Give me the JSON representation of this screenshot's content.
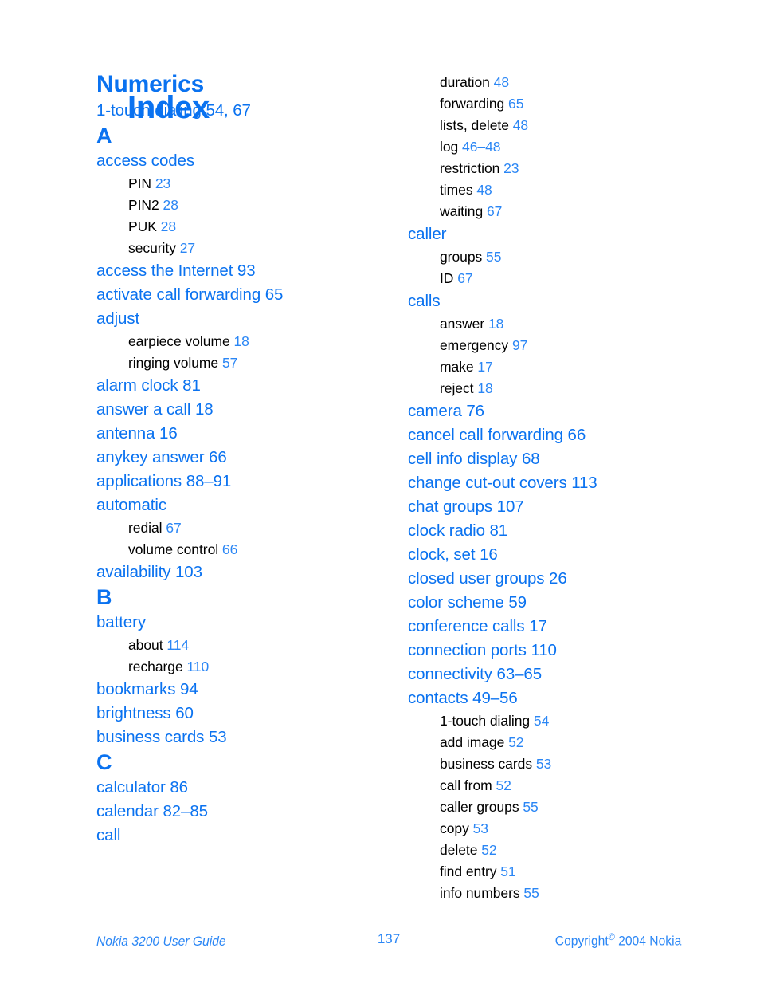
{
  "document": {
    "title": "Index",
    "page_number": "137"
  },
  "footer": {
    "left": "Nokia 3200 User Guide",
    "center": "137",
    "copyright_prefix": "Copyright",
    "copyright_symbol": "©",
    "copyright_suffix": "2004 Nokia"
  },
  "colors": {
    "accent_blue": "#0a72f0",
    "page_number_blue": "#2a86f5",
    "subentry_black": "#000000",
    "background": "#ffffff"
  },
  "columns": {
    "left": [
      {
        "type": "section-heading",
        "text": "Numerics"
      },
      {
        "type": "entry",
        "label": "1-touch dialing",
        "pages": "54, 67"
      },
      {
        "type": "letter-heading",
        "text": "A"
      },
      {
        "type": "entry",
        "label": "access codes",
        "pages": ""
      },
      {
        "type": "subentry",
        "label": "PIN",
        "pages": "23"
      },
      {
        "type": "subentry",
        "label": "PIN2",
        "pages": "28"
      },
      {
        "type": "subentry",
        "label": "PUK",
        "pages": "28"
      },
      {
        "type": "subentry",
        "label": "security",
        "pages": "27"
      },
      {
        "type": "entry",
        "label": "access the Internet",
        "pages": "93"
      },
      {
        "type": "entry",
        "label": "activate call forwarding",
        "pages": "65"
      },
      {
        "type": "entry",
        "label": "adjust",
        "pages": ""
      },
      {
        "type": "subentry",
        "label": "earpiece volume",
        "pages": "18"
      },
      {
        "type": "subentry",
        "label": "ringing volume",
        "pages": "57"
      },
      {
        "type": "entry",
        "label": "alarm clock",
        "pages": "81"
      },
      {
        "type": "entry",
        "label": "answer a call",
        "pages": "18"
      },
      {
        "type": "entry",
        "label": "antenna",
        "pages": "16"
      },
      {
        "type": "entry",
        "label": "anykey answer",
        "pages": "66"
      },
      {
        "type": "entry",
        "label": "applications",
        "pages": "88–91"
      },
      {
        "type": "entry",
        "label": "automatic",
        "pages": ""
      },
      {
        "type": "subentry",
        "label": "redial",
        "pages": "67"
      },
      {
        "type": "subentry",
        "label": "volume control",
        "pages": "66"
      },
      {
        "type": "entry",
        "label": "availability",
        "pages": "103"
      },
      {
        "type": "letter-heading",
        "text": "B"
      },
      {
        "type": "entry",
        "label": "battery",
        "pages": ""
      },
      {
        "type": "subentry",
        "label": "about",
        "pages": "114"
      },
      {
        "type": "subentry",
        "label": "recharge",
        "pages": "110"
      },
      {
        "type": "entry",
        "label": "bookmarks",
        "pages": "94"
      },
      {
        "type": "entry",
        "label": "brightness",
        "pages": "60"
      },
      {
        "type": "entry",
        "label": "business cards",
        "pages": "53"
      },
      {
        "type": "letter-heading",
        "text": "C"
      },
      {
        "type": "entry",
        "label": "calculator",
        "pages": "86"
      },
      {
        "type": "entry",
        "label": "calendar",
        "pages": "82–85"
      },
      {
        "type": "entry",
        "label": "call",
        "pages": ""
      }
    ],
    "right": [
      {
        "type": "subentry",
        "label": "duration",
        "pages": "48"
      },
      {
        "type": "subentry",
        "label": "forwarding",
        "pages": "65"
      },
      {
        "type": "subentry",
        "label": "lists, delete",
        "pages": "48"
      },
      {
        "type": "subentry",
        "label": "log",
        "pages": "46–48"
      },
      {
        "type": "subentry",
        "label": "restriction",
        "pages": "23"
      },
      {
        "type": "subentry",
        "label": "times",
        "pages": "48"
      },
      {
        "type": "subentry",
        "label": "waiting",
        "pages": "67"
      },
      {
        "type": "entry",
        "label": "caller",
        "pages": ""
      },
      {
        "type": "subentry",
        "label": "groups",
        "pages": "55"
      },
      {
        "type": "subentry",
        "label": "ID",
        "pages": "67"
      },
      {
        "type": "entry",
        "label": "calls",
        "pages": ""
      },
      {
        "type": "subentry",
        "label": "answer",
        "pages": "18"
      },
      {
        "type": "subentry",
        "label": "emergency",
        "pages": "97"
      },
      {
        "type": "subentry",
        "label": "make",
        "pages": "17"
      },
      {
        "type": "subentry",
        "label": "reject",
        "pages": "18"
      },
      {
        "type": "entry",
        "label": "camera",
        "pages": "76"
      },
      {
        "type": "entry",
        "label": "cancel call forwarding",
        "pages": "66"
      },
      {
        "type": "entry",
        "label": "cell info display",
        "pages": "68"
      },
      {
        "type": "entry",
        "label": "change cut-out covers",
        "pages": "113"
      },
      {
        "type": "entry",
        "label": "chat groups",
        "pages": "107"
      },
      {
        "type": "entry",
        "label": "clock radio",
        "pages": "81"
      },
      {
        "type": "entry",
        "label": "clock, set",
        "pages": "16"
      },
      {
        "type": "entry",
        "label": "closed user groups",
        "pages": "26"
      },
      {
        "type": "entry",
        "label": "color scheme",
        "pages": "59"
      },
      {
        "type": "entry",
        "label": "conference calls",
        "pages": "17"
      },
      {
        "type": "entry",
        "label": "connection ports",
        "pages": "110"
      },
      {
        "type": "entry",
        "label": "connectivity",
        "pages": "63–65"
      },
      {
        "type": "entry",
        "label": "contacts",
        "pages": "49–56"
      },
      {
        "type": "subentry",
        "label": "1-touch dialing",
        "pages": "54"
      },
      {
        "type": "subentry",
        "label": "add image",
        "pages": "52"
      },
      {
        "type": "subentry",
        "label": "business cards",
        "pages": "53"
      },
      {
        "type": "subentry",
        "label": "call from",
        "pages": "52"
      },
      {
        "type": "subentry",
        "label": "caller groups",
        "pages": "55"
      },
      {
        "type": "subentry",
        "label": "copy",
        "pages": "53"
      },
      {
        "type": "subentry",
        "label": "delete",
        "pages": "52"
      },
      {
        "type": "subentry",
        "label": "find entry",
        "pages": "51"
      },
      {
        "type": "subentry",
        "label": "info numbers",
        "pages": "55"
      }
    ]
  }
}
